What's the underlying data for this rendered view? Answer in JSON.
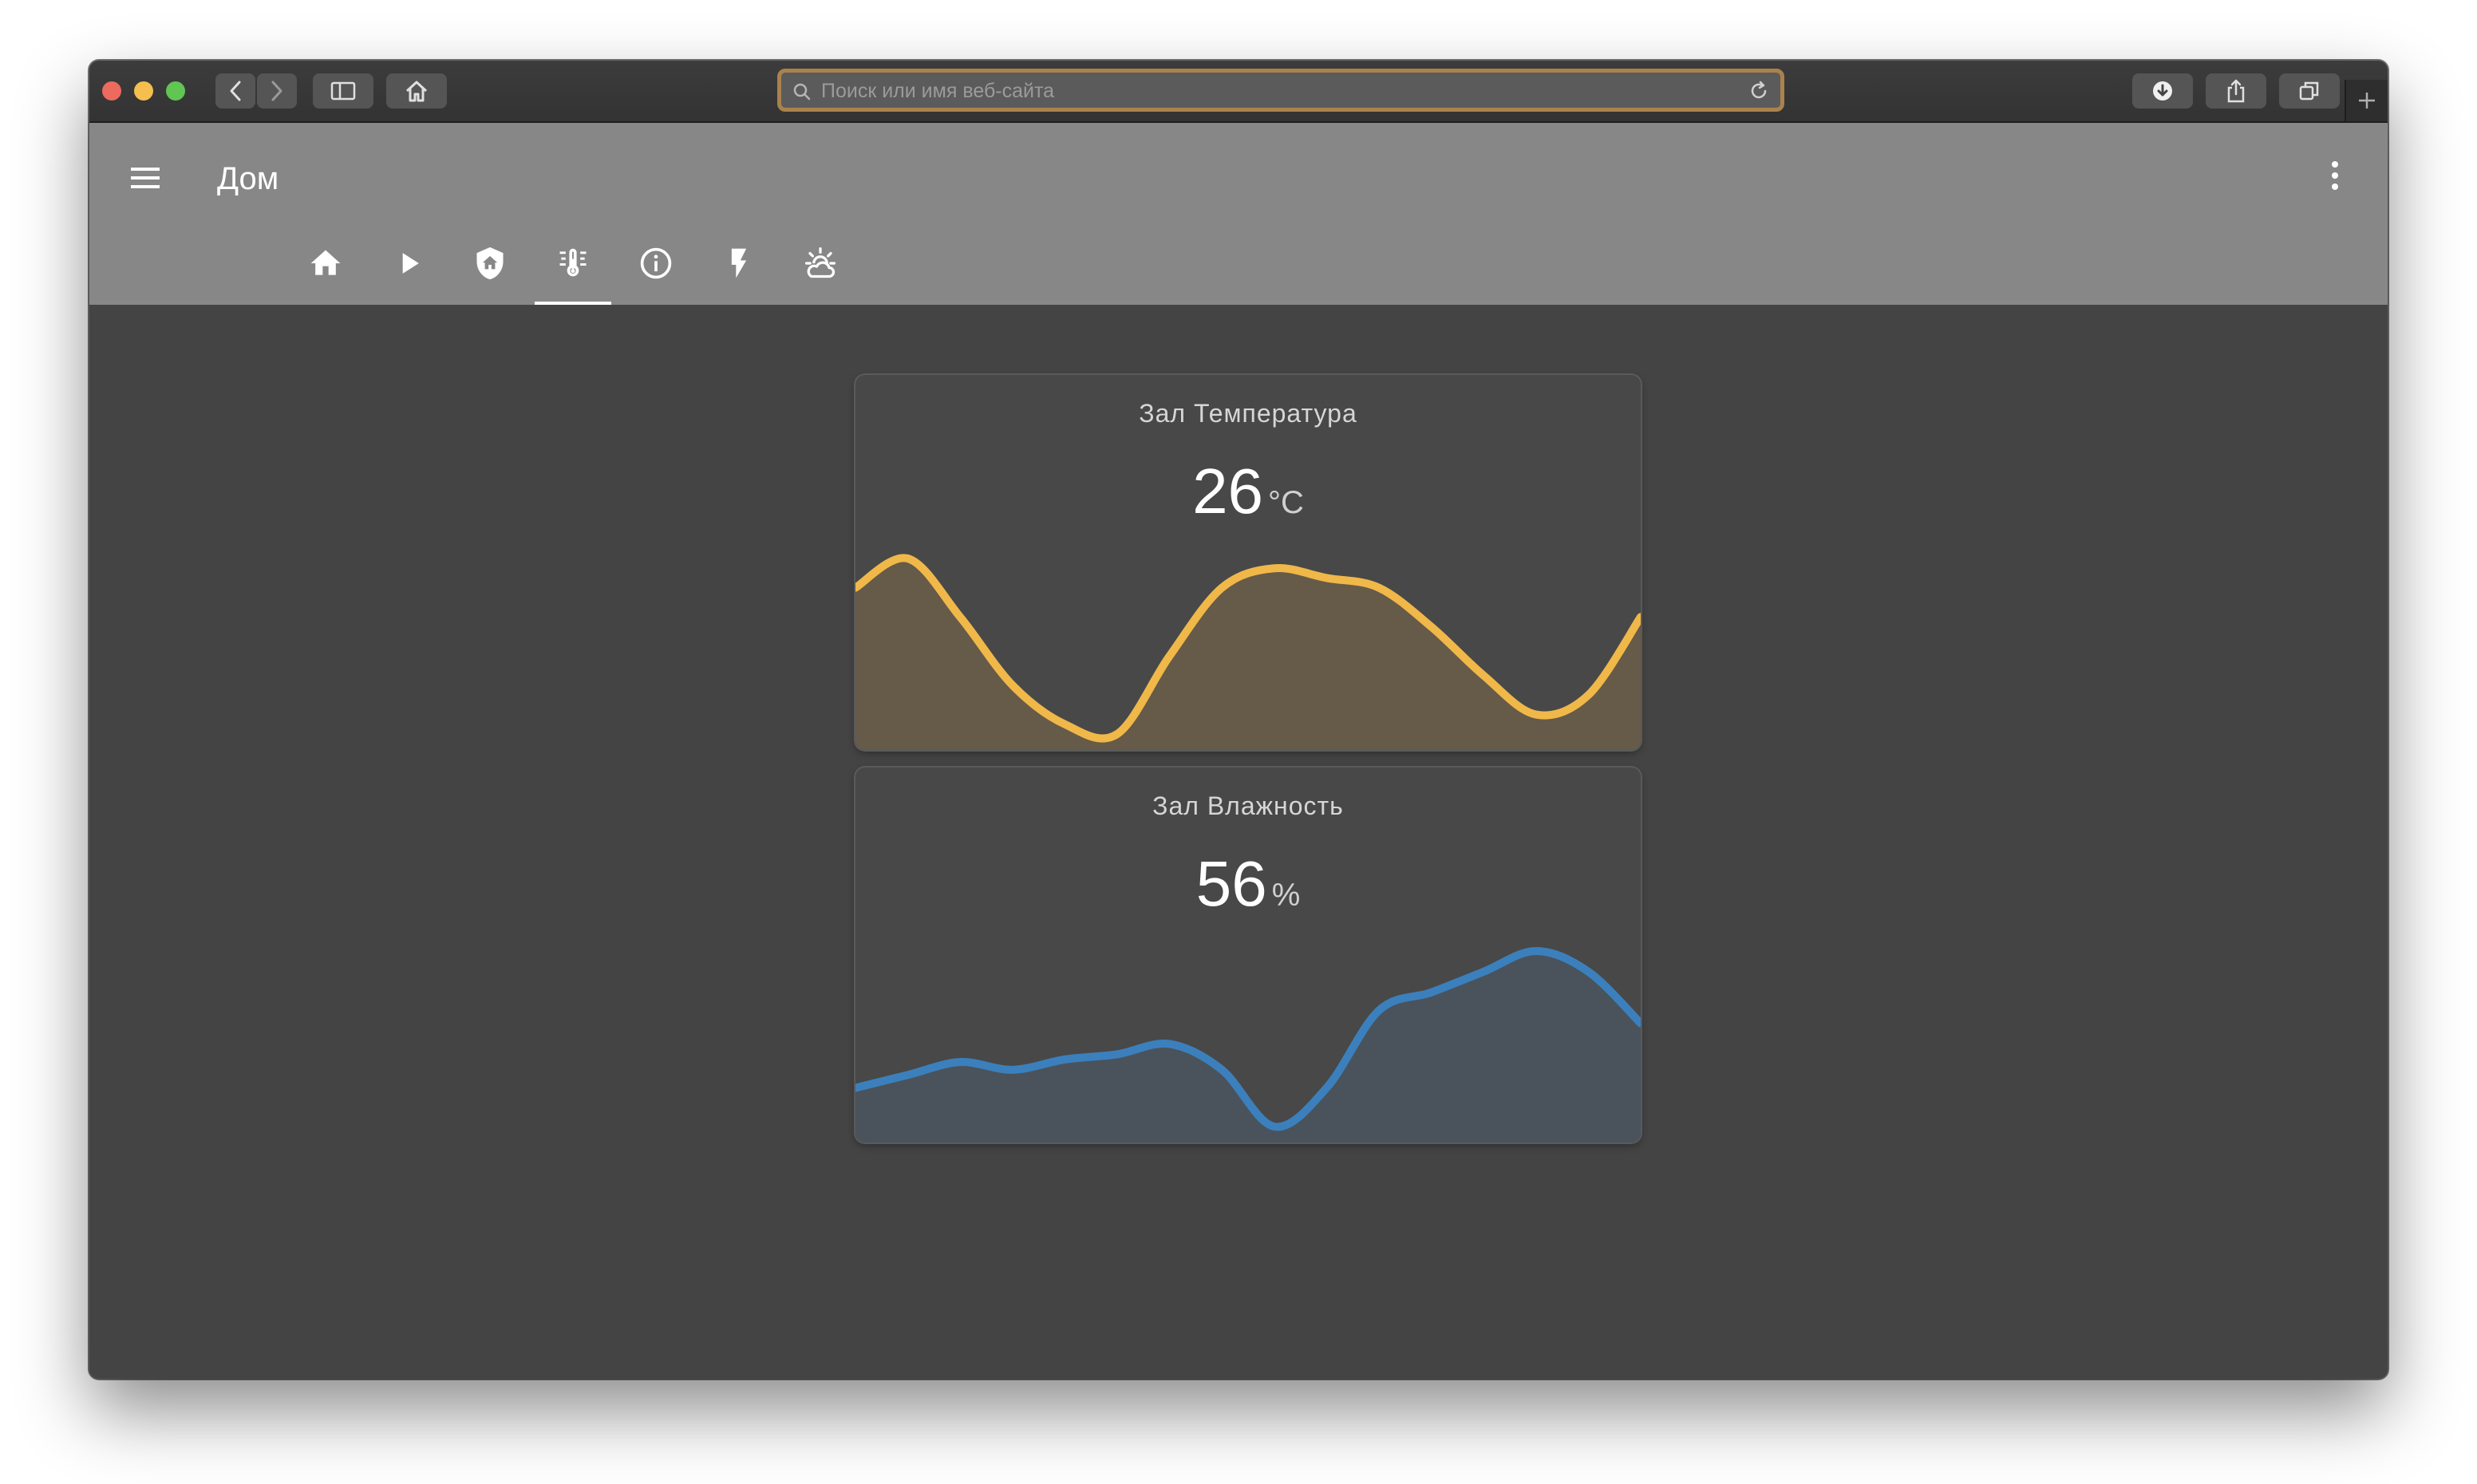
{
  "browser": {
    "address_placeholder": "Поиск или имя веб-сайта",
    "traffic_colors": [
      "#ed6a5e",
      "#f4bf4f",
      "#61c554"
    ],
    "url_focus_color": "#a9824d"
  },
  "app": {
    "title": "Дом",
    "tabs": [
      {
        "icon": "home-icon",
        "active": false
      },
      {
        "icon": "play-icon",
        "active": false
      },
      {
        "icon": "shield-home-icon",
        "active": false
      },
      {
        "icon": "thermometer-icon",
        "active": true
      },
      {
        "icon": "info-icon",
        "active": false
      },
      {
        "icon": "flash-icon",
        "active": false
      },
      {
        "icon": "weather-partly-cloudy-icon",
        "active": false
      }
    ]
  },
  "cards": [
    {
      "name": "Зал Температура",
      "value": "26",
      "unit": "°C",
      "color": "#f0b849",
      "fill": "#665a49",
      "history": [
        29.5,
        31.0,
        28.0,
        24.5,
        22.5,
        22.0,
        26.0,
        29.5,
        30.5,
        30.0,
        29.5,
        27.5,
        25.0,
        23.0,
        24.0,
        28.0
      ]
    },
    {
      "name": "Зал Влажность",
      "value": "56",
      "unit": "%",
      "color": "#3b80bd",
      "fill": "#4a535b",
      "history": [
        54.5,
        55.0,
        55.5,
        55.2,
        55.6,
        55.8,
        56.2,
        55.2,
        53.0,
        54.5,
        57.5,
        58.2,
        59.0,
        59.8,
        59.0,
        57.0
      ]
    }
  ]
}
